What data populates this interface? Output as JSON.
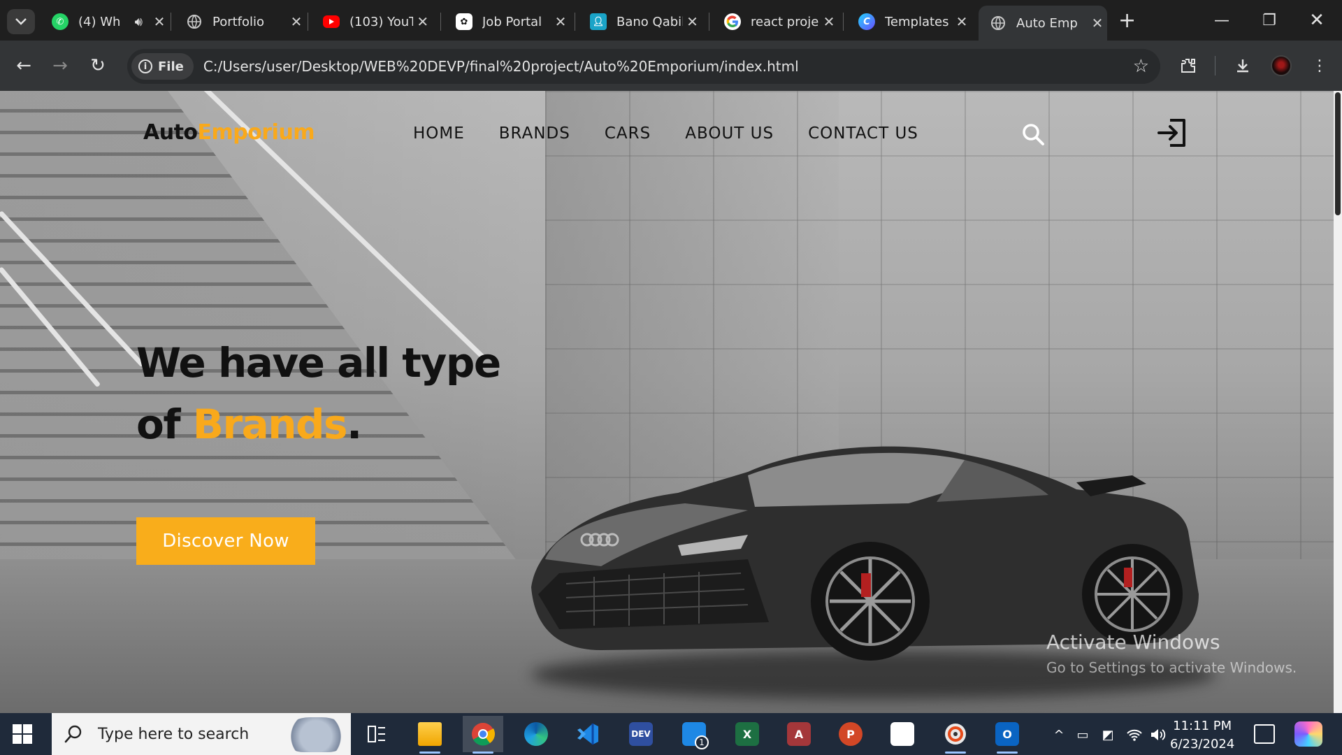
{
  "browser": {
    "tabs": [
      {
        "title": "(4) Wh",
        "favicon": "whatsapp-icon",
        "color": "#25d366",
        "audio": true
      },
      {
        "title": "Portfolio",
        "favicon": "globe-icon",
        "color": "#9aa0a6"
      },
      {
        "title": "(103) YouT",
        "favicon": "youtube-icon",
        "color": "#ff0000"
      },
      {
        "title": "Job Portal",
        "favicon": "openai-icon",
        "color": "#ffffff"
      },
      {
        "title": "Bano Qabil",
        "favicon": "user-card-icon",
        "color": "#1aa4c8"
      },
      {
        "title": "react proje",
        "favicon": "google-icon",
        "color": "#4285f4"
      },
      {
        "title": "Templates",
        "favicon": "canva-icon",
        "color": "#3b82f6"
      },
      {
        "title": "Auto Emp",
        "favicon": "globe-icon",
        "color": "#9aa0a6",
        "active": true
      }
    ],
    "address": {
      "scheme_label": "File",
      "url": "C:/Users/user/Desktop/WEB%20DEVP/final%20project/Auto%20Emporium/index.html"
    }
  },
  "site": {
    "logo": {
      "part1": "Auto",
      "part2": "Emporium"
    },
    "nav": [
      "HOME",
      "BRANDS",
      "CARS",
      "ABOUT US",
      "CONTACT US"
    ],
    "hero": {
      "line1": "We have all type",
      "line2_prefix": "of ",
      "line2_accent": "Brands",
      "line2_suffix": "."
    },
    "cta_label": "Discover Now",
    "accent_color": "#f9a91b"
  },
  "watermark": {
    "line1": "Activate Windows",
    "line2": "Go to Settings to activate Windows."
  },
  "taskbar": {
    "search_placeholder": "Type here to search",
    "time": "11:11 PM",
    "date": "6/23/2024",
    "mail_badge": "1",
    "apps": [
      {
        "name": "task-view-icon"
      },
      {
        "name": "file-explorer-icon"
      },
      {
        "name": "chrome-icon"
      },
      {
        "name": "edge-icon"
      },
      {
        "name": "vscode-icon"
      },
      {
        "name": "dev-home-icon"
      },
      {
        "name": "mail-icon"
      },
      {
        "name": "excel-icon"
      },
      {
        "name": "access-icon"
      },
      {
        "name": "powerpoint-icon"
      },
      {
        "name": "store-icon"
      },
      {
        "name": "media-player-icon"
      },
      {
        "name": "outlook-new-icon"
      }
    ]
  }
}
